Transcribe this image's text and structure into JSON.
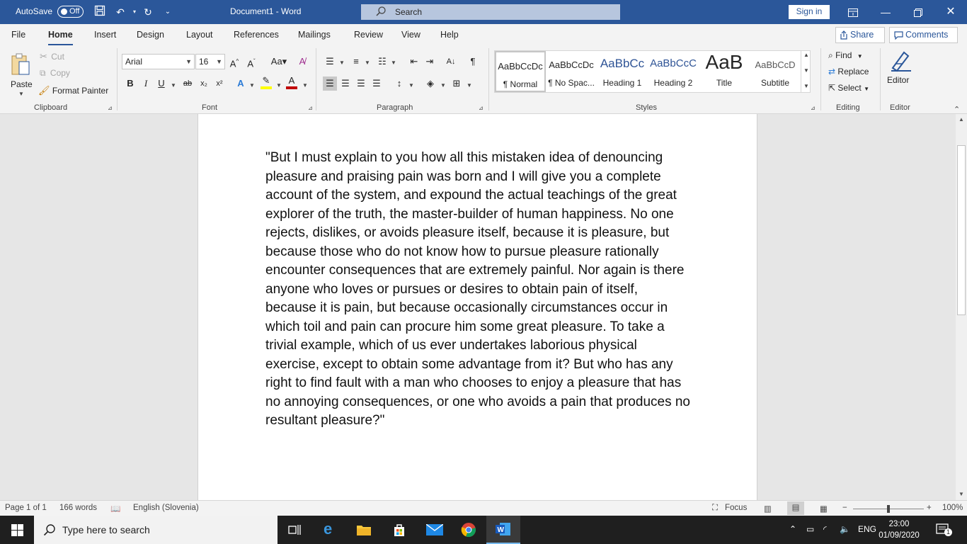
{
  "titlebar": {
    "autosave_label": "AutoSave",
    "autosave_state": "Off",
    "doc_title": "Document1  -  Word",
    "search_placeholder": "Search",
    "signin_label": "Sign in"
  },
  "tabs": [
    "File",
    "Home",
    "Insert",
    "Design",
    "Layout",
    "References",
    "Mailings",
    "Review",
    "View",
    "Help"
  ],
  "active_tab": "Home",
  "share_label": "Share",
  "comments_label": "Comments",
  "clipboard": {
    "paste": "Paste",
    "cut": "Cut",
    "copy": "Copy",
    "format_painter": "Format Painter",
    "group_label": "Clipboard"
  },
  "font": {
    "family": "Arial",
    "size": "16",
    "group_label": "Font"
  },
  "paragraph": {
    "group_label": "Paragraph"
  },
  "styles": {
    "items": [
      {
        "preview": "AaBbCcDc",
        "name": "¶ Normal"
      },
      {
        "preview": "AaBbCcDc",
        "name": "¶ No Spac..."
      },
      {
        "preview": "AaBbCc",
        "name": "Heading 1"
      },
      {
        "preview": "AaBbCcC",
        "name": "Heading 2"
      },
      {
        "preview": "AaB",
        "name": "Title"
      },
      {
        "preview": "AaBbCcD",
        "name": "Subtitle"
      }
    ],
    "group_label": "Styles"
  },
  "editing": {
    "find": "Find",
    "replace": "Replace",
    "select": "Select",
    "group_label": "Editing"
  },
  "editor": {
    "label": "Editor",
    "group_label": "Editor"
  },
  "document": {
    "text": "\"But I must explain to you how all this mistaken idea of denouncing pleasure and praising pain was born and I will give you a complete account of the system, and expound the actual teachings of the great explorer of the truth, the master-builder of human happiness. No one rejects, dislikes, or avoids pleasure itself, because it is pleasure, but because those who do not know how to pursue pleasure rationally encounter consequences that are extremely painful. Nor again is there anyone who loves or pursues or desires to obtain pain of itself, because it is pain, but because occasionally circumstances occur in which toil and pain can procure him some great pleasure. To take a trivial example, which of us ever undertakes laborious physical exercise, except to obtain some advantage from it? But who has any right to find fault with a man who chooses to enjoy a pleasure that has no annoying consequences, or one who avoids a pain that produces no resultant pleasure?\""
  },
  "status": {
    "page": "Page 1 of 1",
    "words": "166 words",
    "language": "English (Slovenia)",
    "focus": "Focus",
    "zoom": "100%"
  },
  "taskbar": {
    "search_placeholder": "Type here to search",
    "lang": "ENG",
    "time": "23:00",
    "date": "01/09/2020",
    "notifications": "1"
  },
  "colors": {
    "titlebar": "#2b579a",
    "highlight": "#ffff00",
    "font_color": "#c00000"
  }
}
